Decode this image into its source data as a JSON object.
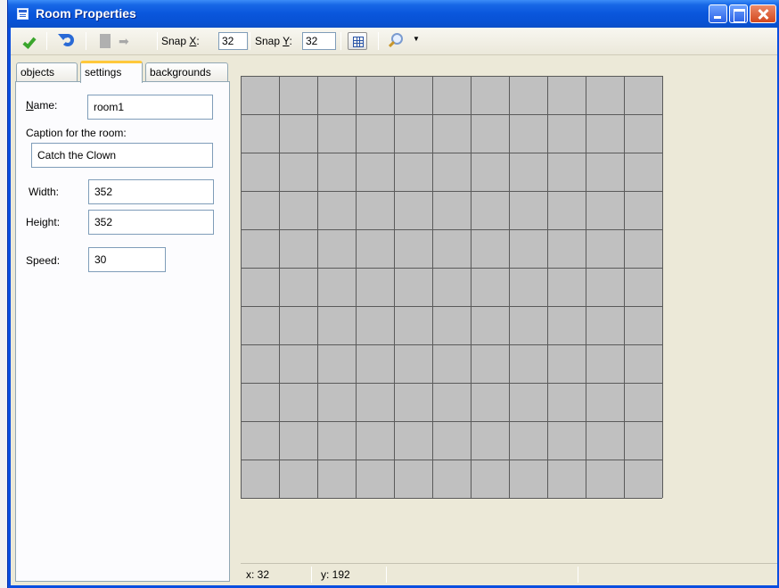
{
  "window": {
    "title": "Room Properties"
  },
  "toolbar": {
    "snap_x_label_prefix": "Snap ",
    "snap_x_label_key": "X",
    "snap_x_label_suffix": ":",
    "snap_x_value": "32",
    "snap_y_label_prefix": "Snap ",
    "snap_y_label_key": "Y",
    "snap_y_label_suffix": ":",
    "snap_y_value": "32",
    "zoom_dropdown_glyph": "▼"
  },
  "tabs": {
    "objects": "objects",
    "settings": "settings",
    "backgrounds": "backgrounds"
  },
  "settings": {
    "name_label_key": "N",
    "name_label_rest": "ame:",
    "name_value": "room1",
    "caption_label": "Caption for the room:",
    "caption_value": "Catch the Clown",
    "width_label": "Width:",
    "width_value": "352",
    "height_label": "Height:",
    "height_value": "352",
    "speed_label": "Speed:",
    "speed_value": "30"
  },
  "room": {
    "columns": 11,
    "rows": 11,
    "cell_color": "#c0c0c0",
    "line_color": "#5a5a5a"
  },
  "status": {
    "x": "x: 32",
    "y": "y: 192"
  }
}
